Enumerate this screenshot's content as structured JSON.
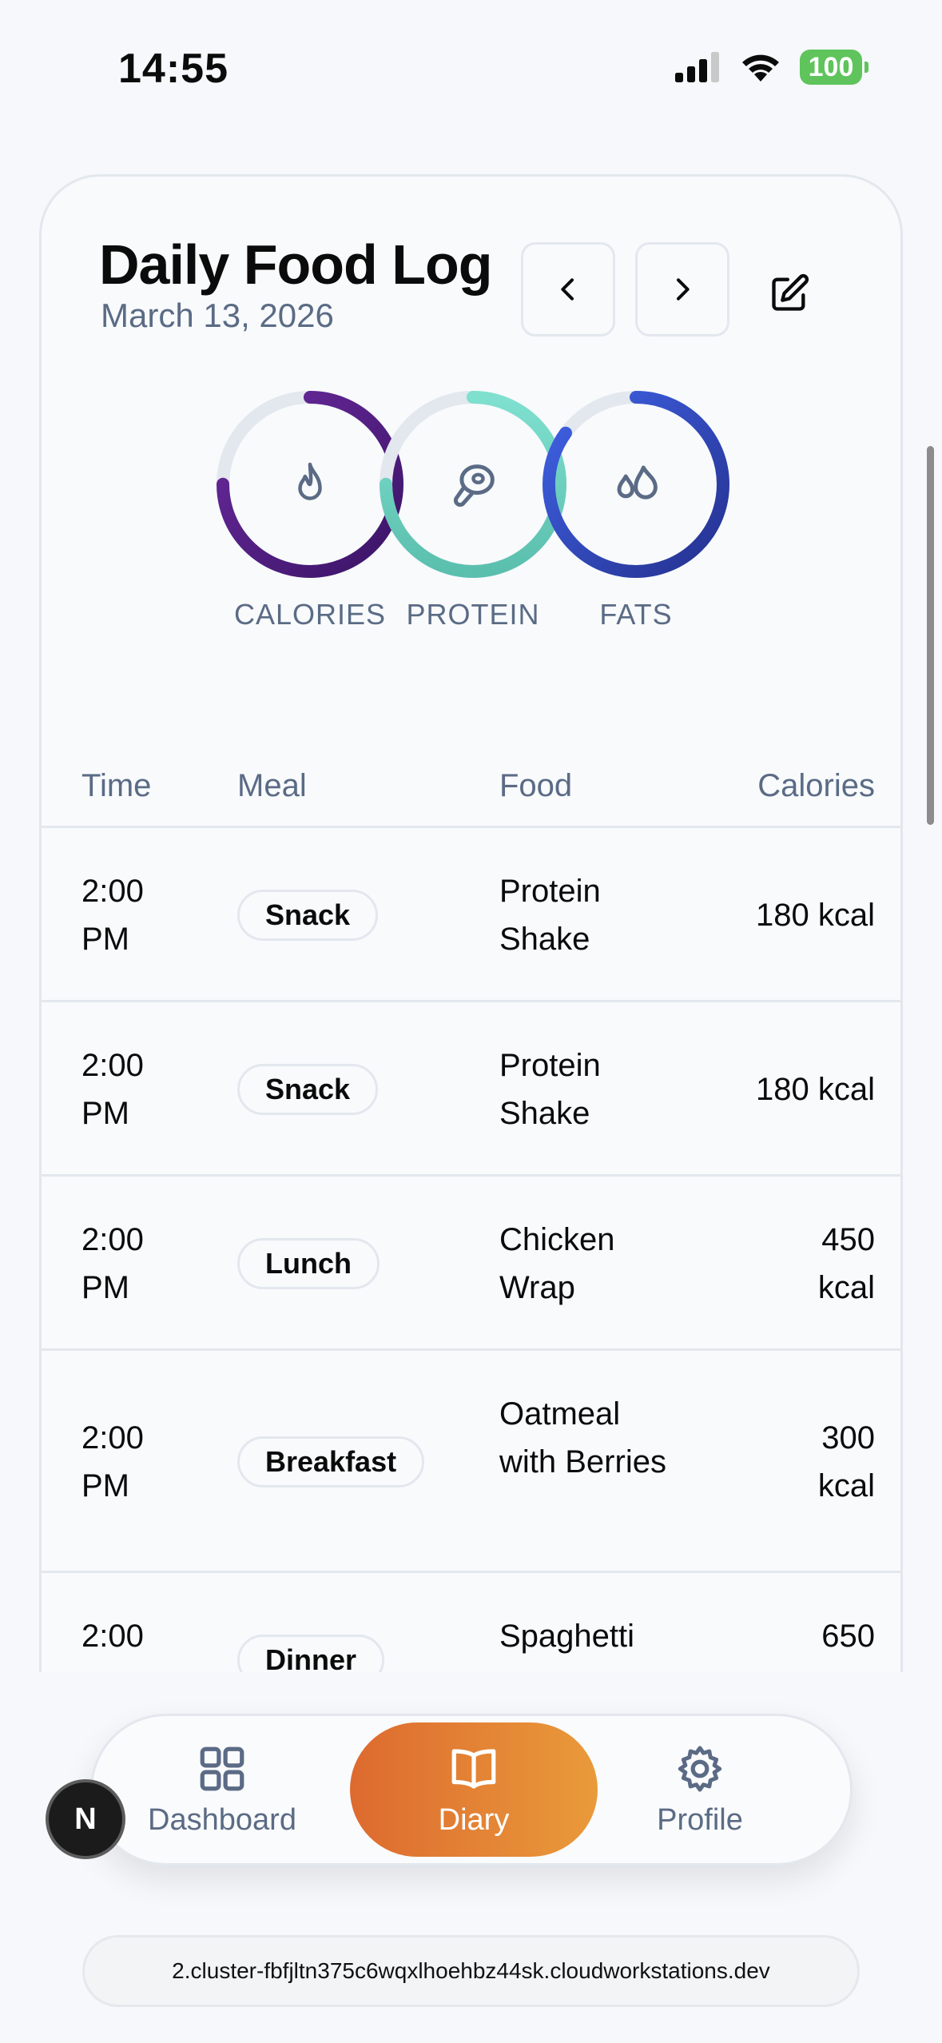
{
  "status_bar": {
    "time": "14:55",
    "battery": "100",
    "icons": [
      "signal-icon",
      "wifi-icon",
      "battery-icon"
    ]
  },
  "header": {
    "title": "Daily Food Log",
    "date": "March 13, 2026",
    "prev_icon": "chevron-left-icon",
    "next_icon": "chevron-right-icon",
    "edit_icon": "edit-icon"
  },
  "rings": [
    {
      "label": "CALORIES",
      "icon": "flame-icon",
      "progress": 0.75,
      "color_start": "#3a1466",
      "color_end": "#6b2a9e"
    },
    {
      "label": "PROTEIN",
      "icon": "meat-icon",
      "progress": 0.75,
      "color_start": "#5bbfae",
      "color_end": "#7fe0cf"
    },
    {
      "label": "FATS",
      "icon": "droplets-icon",
      "progress": 0.85,
      "color_start": "#25308e",
      "color_end": "#3f63e6"
    }
  ],
  "table": {
    "headers": {
      "time": "Time",
      "meal": "Meal",
      "food": "Food",
      "calories": "Calories"
    },
    "rows": [
      {
        "time": "2:00 PM",
        "meal": "Snack",
        "food": "Protein Shake",
        "calories": "180 kcal"
      },
      {
        "time": "2:00 PM",
        "meal": "Snack",
        "food": "Protein Shake",
        "calories": "180 kcal"
      },
      {
        "time": "2:00 PM",
        "meal": "Lunch",
        "food": "Chicken Wrap",
        "calories": "450 kcal"
      },
      {
        "time": "2:00 PM",
        "meal": "Breakfast",
        "food": "Oatmeal with Berries",
        "calories": "300 kcal"
      },
      {
        "time": "2:00",
        "meal": "Dinner",
        "food": "Spaghetti",
        "calories": "650"
      }
    ]
  },
  "bottom_nav": {
    "tabs": [
      {
        "label": "Dashboard",
        "icon": "grid-icon",
        "active": false
      },
      {
        "label": "Diary",
        "icon": "book-icon",
        "active": true
      },
      {
        "label": "Profile",
        "icon": "gear-icon",
        "active": false
      }
    ]
  },
  "dev_badge": "N",
  "url": "2.cluster-fbfjltn375c6wqxlhoehbz44sk.cloudworkstations.dev"
}
